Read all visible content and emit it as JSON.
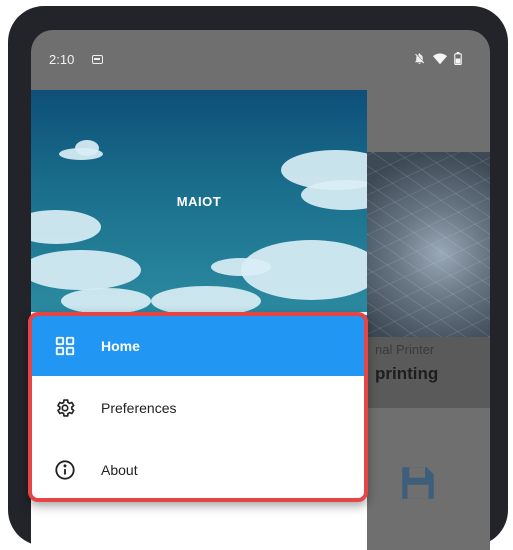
{
  "status_bar": {
    "time": "2:10",
    "icons": [
      "calendar-icon",
      "notifications-off-icon",
      "wifi-icon",
      "battery-icon"
    ]
  },
  "background_content": {
    "card_overline": "nal Printer",
    "card_title": "printing",
    "icons": [
      "save-icon"
    ]
  },
  "drawer": {
    "header_title": "MAIOT",
    "items": [
      {
        "label": "Home",
        "icon": "grid-icon",
        "active": true
      },
      {
        "label": "Preferences",
        "icon": "gear-icon",
        "active": false
      },
      {
        "label": "About",
        "icon": "info-icon",
        "active": false
      }
    ]
  },
  "colors": {
    "accent": "#2196f3",
    "highlight_border": "#e64545",
    "scrim": "#6f6f6f",
    "device_frame": "#23232a"
  }
}
